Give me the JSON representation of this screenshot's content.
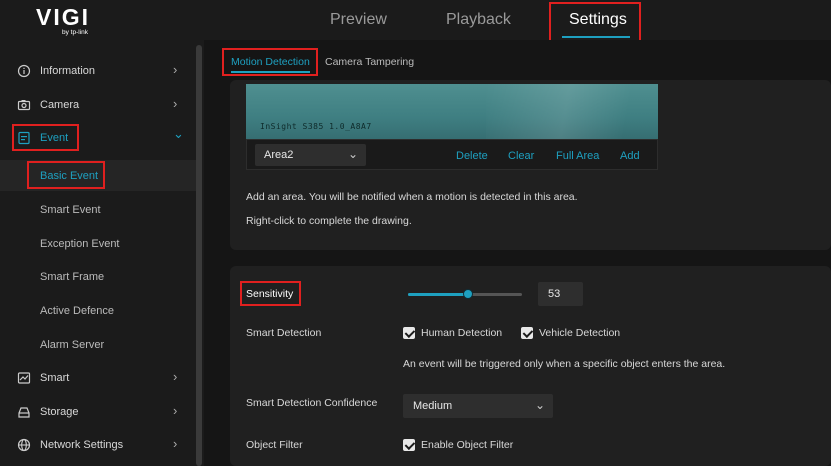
{
  "brand": {
    "logo": "VIGI",
    "logo_sub": "by tp-link"
  },
  "top_tabs": [
    {
      "label": "Preview"
    },
    {
      "label": "Playback"
    },
    {
      "label": "Settings"
    }
  ],
  "sidebar": {
    "items": [
      {
        "label": "Information",
        "icon": "info-icon",
        "chevron": "›"
      },
      {
        "label": "Camera",
        "icon": "camera-icon",
        "chevron": "›"
      },
      {
        "label": "Event",
        "icon": "event-icon",
        "chevron": "⌄"
      },
      {
        "label": "Basic Event"
      },
      {
        "label": "Smart Event"
      },
      {
        "label": "Exception Event"
      },
      {
        "label": "Smart Frame"
      },
      {
        "label": "Active Defence"
      },
      {
        "label": "Alarm Server"
      },
      {
        "label": "Smart",
        "icon": "smart-icon",
        "chevron": "›"
      },
      {
        "label": "Storage",
        "icon": "storage-icon",
        "chevron": "›"
      },
      {
        "label": "Network Settings",
        "icon": "network-icon",
        "chevron": "›"
      }
    ]
  },
  "sub_tabs": [
    {
      "label": "Motion Detection"
    },
    {
      "label": "Camera Tampering"
    }
  ],
  "area": {
    "osd": "InSight S385 1.0_A8A7",
    "selected": "Area2",
    "chevron": "⌄",
    "actions": {
      "delete": "Delete",
      "clear": "Clear",
      "full_area": "Full Area",
      "add": "Add"
    },
    "hint1": "Add an area. You will be notified when a motion is detected in this area.",
    "hint2": "Right-click to complete the drawing."
  },
  "sensitivity": {
    "label": "Sensitivity",
    "value": "53",
    "level": 0.53
  },
  "smart_detection": {
    "label": "Smart Detection",
    "human": "Human Detection",
    "vehicle": "Vehicle Detection",
    "note": "An event will be triggered only when a specific object enters the area."
  },
  "confidence": {
    "label": "Smart Detection Confidence",
    "value": "Medium",
    "chevron": "⌄"
  },
  "object_filter": {
    "label": "Object Filter",
    "checkbox": "Enable Object Filter"
  },
  "colors": {
    "accent": "#1ea0c0",
    "highlight_box": "#e0201f",
    "background": "#1b1b1b"
  }
}
